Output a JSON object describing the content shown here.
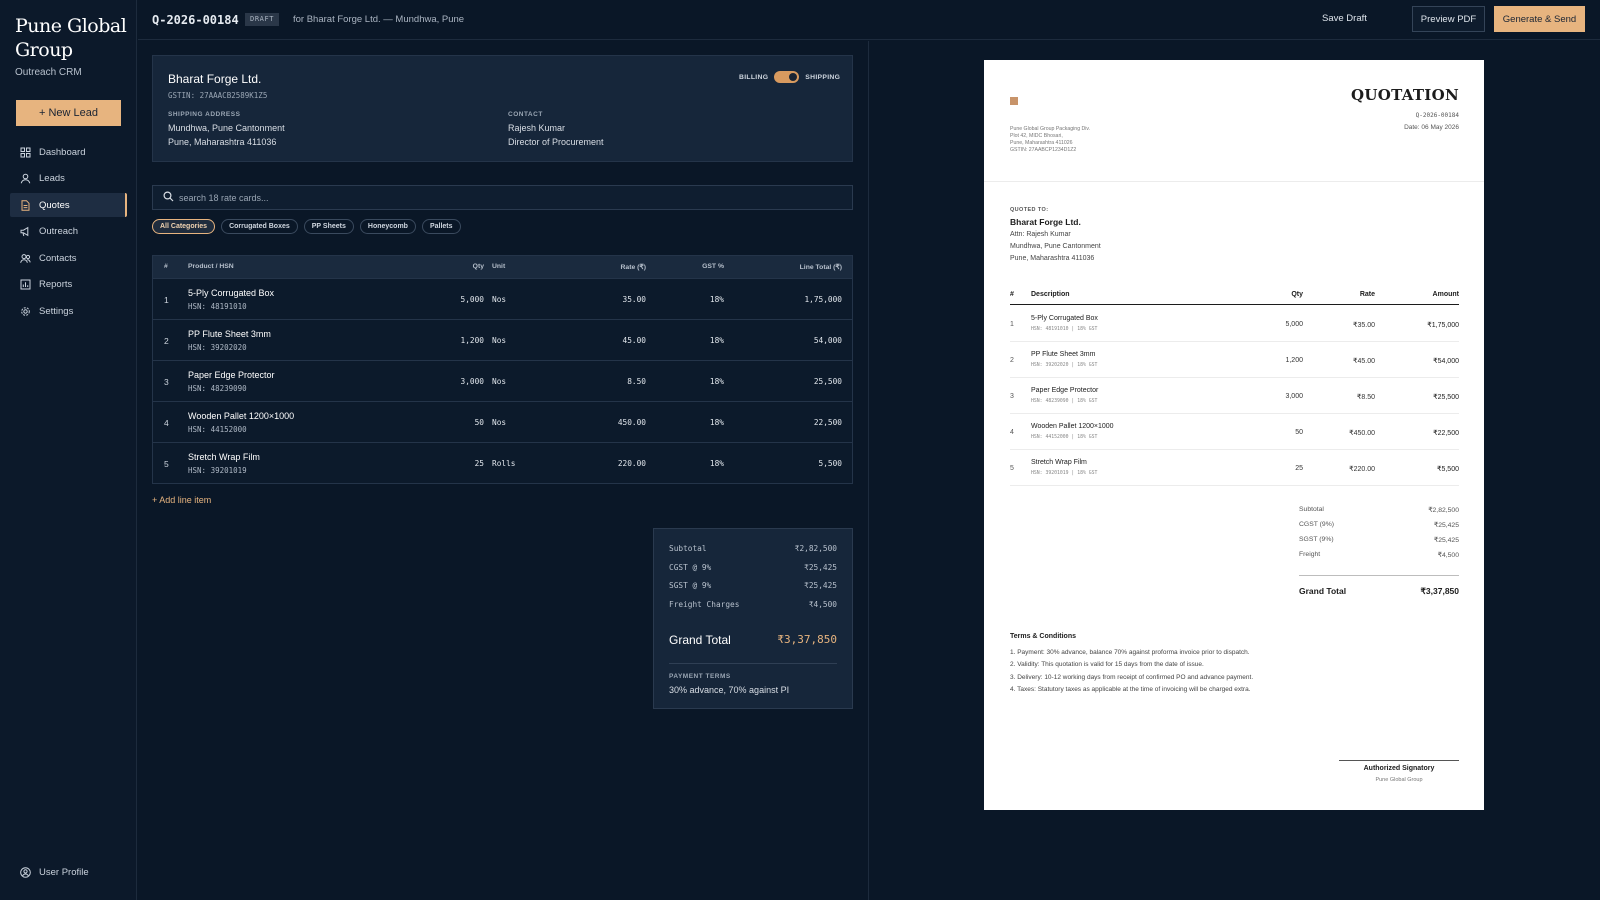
{
  "sidebar": {
    "brand": "Pune Global Group",
    "subtitle": "Outreach CRM",
    "new_lead": "+ New Lead",
    "items": [
      {
        "label": "Dashboard",
        "icon": "grid-icon"
      },
      {
        "label": "Leads",
        "icon": "user-icon"
      },
      {
        "label": "Quotes",
        "icon": "document-icon",
        "active": true
      },
      {
        "label": "Outreach",
        "icon": "megaphone-icon"
      },
      {
        "label": "Contacts",
        "icon": "users-icon"
      },
      {
        "label": "Reports",
        "icon": "chart-icon"
      },
      {
        "label": "Settings",
        "icon": "gear-icon"
      }
    ],
    "user_profile": "User Profile"
  },
  "topbar": {
    "quote_number": "Q-2026-00184",
    "status": "DRAFT",
    "subtitle": "for Bharat Forge Ltd. — Mundhwa, Pune",
    "save_draft": "Save Draft",
    "preview_pdf": "Preview PDF",
    "generate_send": "Generate & Send"
  },
  "customer": {
    "name": "Bharat Forge Ltd.",
    "gstin": "GSTIN: 27AAACB2589K1Z5",
    "toggle_left": "BILLING",
    "toggle_right": "SHIPPING",
    "address_label": "SHIPPING ADDRESS",
    "address_line1": "Mundhwa, Pune Cantonment",
    "address_line2": "Pune, Maharashtra 411036",
    "contact_label": "CONTACT",
    "contact_name": "Rajesh Kumar",
    "contact_title": "Director of Procurement"
  },
  "search": {
    "placeholder": "search 18 rate cards..."
  },
  "categories": [
    "All Categories",
    "Corrugated Boxes",
    "PP Sheets",
    "Honeycomb",
    "Pallets"
  ],
  "table": {
    "headers": {
      "num": "#",
      "product": "Product / HSN",
      "qty": "Qty",
      "unit": "Unit",
      "rate": "Rate (₹)",
      "gst": "GST %",
      "total": "Line Total (₹)"
    },
    "rows": [
      {
        "num": "1",
        "name": "5-Ply Corrugated Box",
        "hsn": "HSN: 48191010",
        "qty": "5,000",
        "unit": "Nos",
        "rate": "35.00",
        "gst": "18%",
        "total": "1,75,000"
      },
      {
        "num": "2",
        "name": "PP Flute Sheet 3mm",
        "hsn": "HSN: 39202020",
        "qty": "1,200",
        "unit": "Nos",
        "rate": "45.00",
        "gst": "18%",
        "total": "54,000"
      },
      {
        "num": "3",
        "name": "Paper Edge Protector",
        "hsn": "HSN: 48239090",
        "qty": "3,000",
        "unit": "Nos",
        "rate": "8.50",
        "gst": "18%",
        "total": "25,500"
      },
      {
        "num": "4",
        "name": "Wooden Pallet 1200×1000",
        "hsn": "HSN: 44152000",
        "qty": "50",
        "unit": "Nos",
        "rate": "450.00",
        "gst": "18%",
        "total": "22,500"
      },
      {
        "num": "5",
        "name": "Stretch Wrap Film",
        "hsn": "HSN: 39201019",
        "qty": "25",
        "unit": "Rolls",
        "rate": "220.00",
        "gst": "18%",
        "total": "5,500"
      }
    ],
    "add_line": "Add line item"
  },
  "totals": {
    "subtotal_label": "Subtotal",
    "subtotal": "₹2,82,500",
    "cgst_label": "CGST @ 9%",
    "cgst": "₹25,425",
    "sgst_label": "SGST @ 9%",
    "sgst": "₹25,425",
    "freight_label": "Freight Charges",
    "freight": "₹4,500",
    "grand_label": "Grand Total",
    "grand": "₹3,37,850",
    "payment_terms_label": "PAYMENT TERMS",
    "payment_terms": "30% advance, 70% against PI"
  },
  "preview": {
    "title": "QUOTATION",
    "quote_number": "Q-2026-00184",
    "date": "Date: 06 May 2026",
    "from_lines": [
      "Pune Global Group Packaging Div.",
      "Plot 42, MIDC Bhosari,",
      "Pune, Maharashtra 411026",
      "GSTIN: 27AABCP1234D1Z2"
    ],
    "quoted_to_label": "QUOTED TO:",
    "customer": "Bharat Forge Ltd.",
    "attn_lines": [
      "Attn: Rajesh Kumar",
      "Mundhwa, Pune Cantonment",
      "Pune, Maharashtra 411036"
    ],
    "headers": {
      "num": "#",
      "desc": "Description",
      "qty": "Qty",
      "rate": "Rate",
      "amount": "Amount"
    },
    "rows": [
      {
        "num": "1",
        "desc": "5-Ply Corrugated Box",
        "hsn": "HSN: 48191010 | 18% GST",
        "qty": "5,000",
        "rate": "₹35.00",
        "amount": "₹1,75,000"
      },
      {
        "num": "2",
        "desc": "PP Flute Sheet 3mm",
        "hsn": "HSN: 39202020 | 18% GST",
        "qty": "1,200",
        "rate": "₹45.00",
        "amount": "₹54,000"
      },
      {
        "num": "3",
        "desc": "Paper Edge Protector",
        "hsn": "HSN: 48239090 | 18% GST",
        "qty": "3,000",
        "rate": "₹8.50",
        "amount": "₹25,500"
      },
      {
        "num": "4",
        "desc": "Wooden Pallet 1200×1000",
        "hsn": "HSN: 44152000 | 18% GST",
        "qty": "50",
        "rate": "₹450.00",
        "amount": "₹22,500"
      },
      {
        "num": "5",
        "desc": "Stretch Wrap Film",
        "hsn": "HSN: 39201019 | 18% GST",
        "qty": "25",
        "rate": "₹220.00",
        "amount": "₹5,500"
      }
    ],
    "summary": [
      {
        "label": "Subtotal",
        "value": "₹2,82,500"
      },
      {
        "label": "CGST (9%)",
        "value": "₹25,425"
      },
      {
        "label": "SGST (9%)",
        "value": "₹25,425"
      },
      {
        "label": "Freight",
        "value": "₹4,500"
      }
    ],
    "grand_label": "Grand Total",
    "grand": "₹3,37,850",
    "terms_title": "Terms & Conditions",
    "terms": [
      "1. Payment: 30% advance, balance 70% against proforma invoice prior to dispatch.",
      "2. Validity: This quotation is valid for 15 days from the date of issue.",
      "3. Delivery: 10-12 working days from receipt of confirmed PO and advance payment.",
      "4. Taxes: Statutory taxes as applicable at the time of invoicing will be charged extra."
    ],
    "signatory": "Authorized Signatory",
    "signatory_org": "Pune Global Group"
  },
  "colors": {
    "accent": "#e7b47f",
    "background": "#0a1727",
    "panel": "#16263a"
  }
}
